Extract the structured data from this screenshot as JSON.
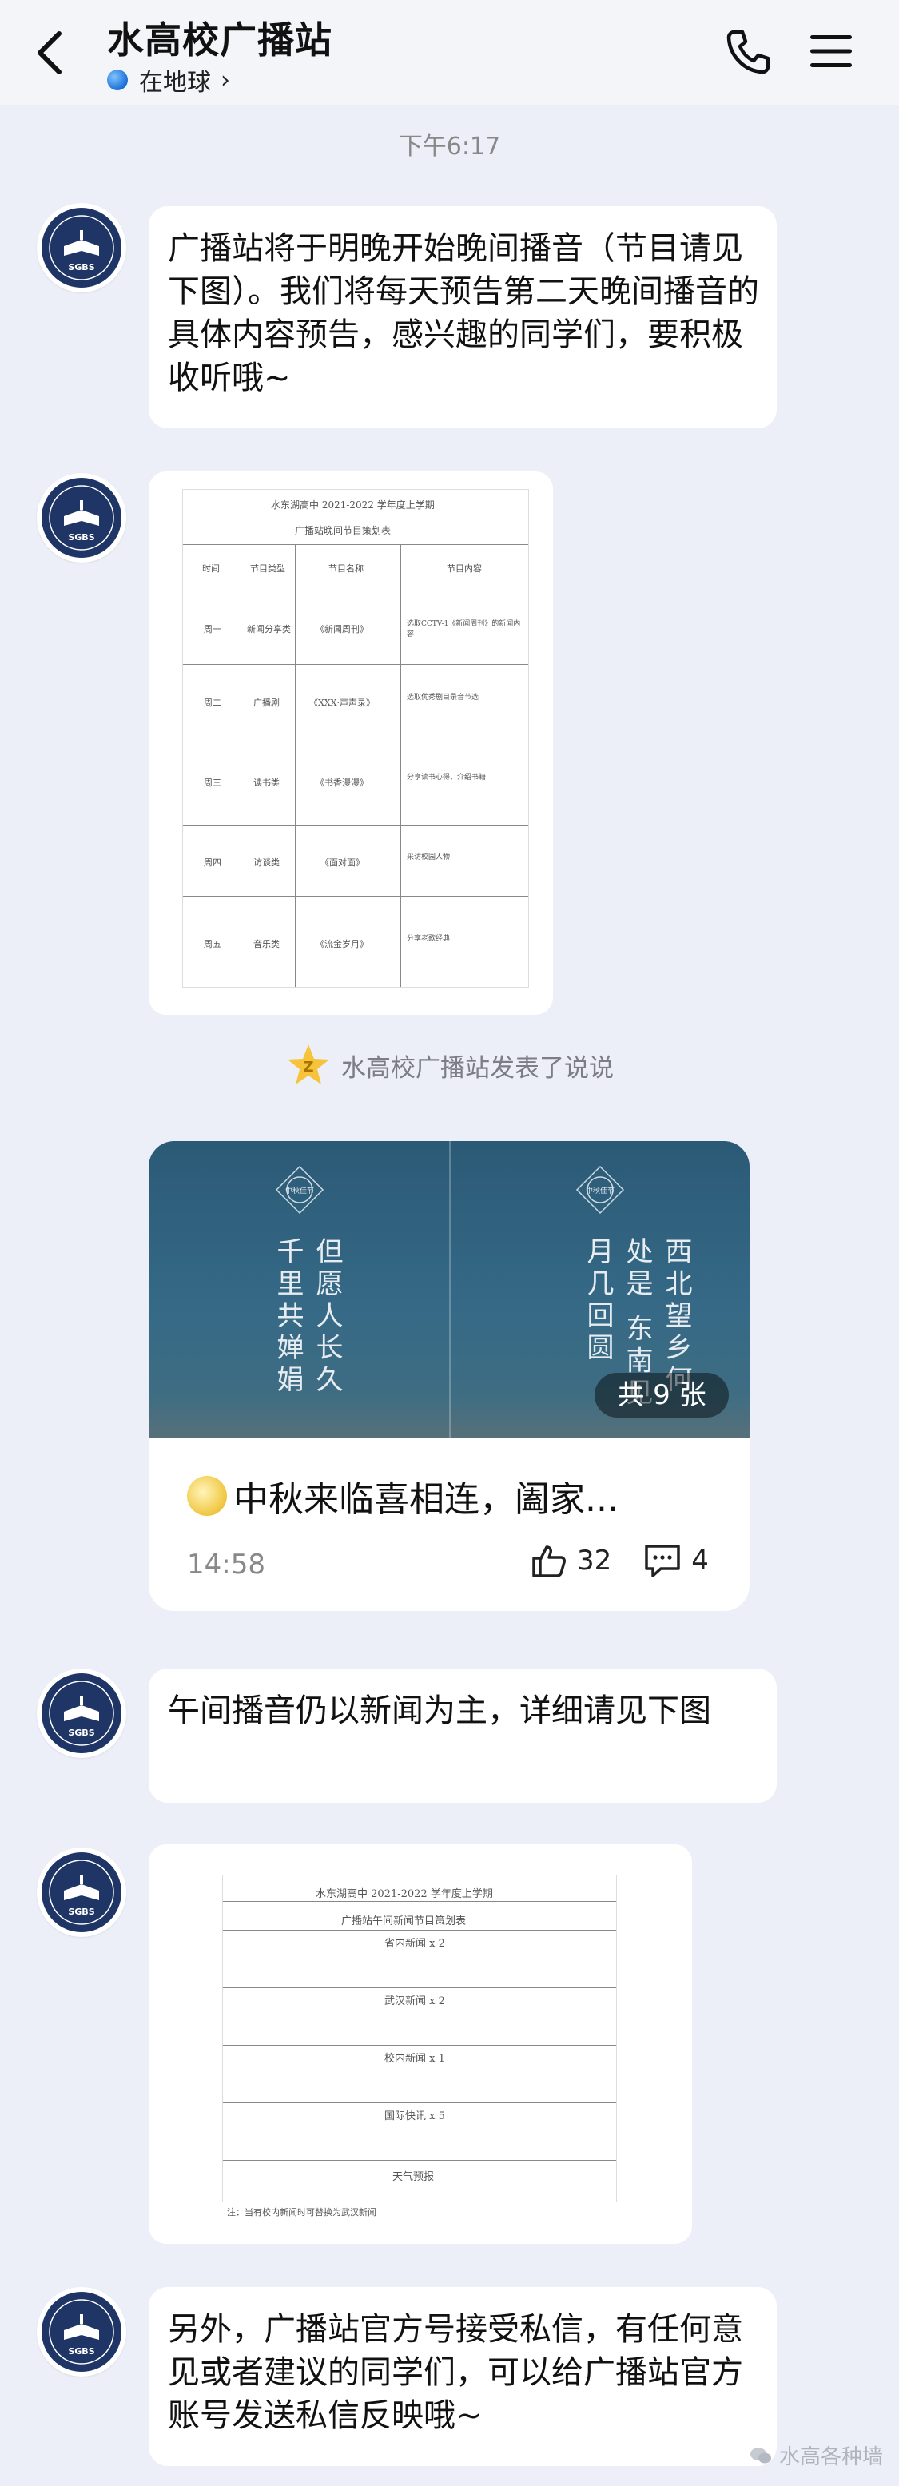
{
  "header": {
    "title": "水高校广播站",
    "location": "在地球",
    "location_chevron": "›"
  },
  "chat": {
    "timestamp": "下午6:17",
    "msg1": "广播站将于明晚开始晚间播音（节目请见下图）。我们将每天预告第二天晚间播音的具体内容预告，感兴趣的同学们，要积极收听哦~",
    "doc1": {
      "title": "水东湖高中 2021-2022 学年度上学期",
      "subtitle": "广播站晚间节目策划表",
      "headers": [
        "时间",
        "节目类型",
        "节目名称",
        "节目内容"
      ],
      "rows": [
        [
          "周一",
          "新闻分享类",
          "《新闻周刊》",
          "选取CCTV-1《新闻周刊》的新闻内容"
        ],
        [
          "周二",
          "广播剧",
          "《XXX·声声录》",
          "选取优秀剧目录音节选"
        ],
        [
          "周三",
          "读书类",
          "《书香漫漫》",
          "分享读书心得，介绍书籍"
        ],
        [
          "周四",
          "访谈类",
          "《面对面》",
          "采访校园人物"
        ],
        [
          "周五",
          "音乐类",
          "《流金岁月》",
          "分享老歌经典"
        ]
      ]
    },
    "notice": "水高校广播站发表了说说",
    "notice_badge": "Z",
    "post": {
      "left_text": "但愿人长久 千里共婵娟",
      "right_text": "西北望乡何处是 东南见月几回圆",
      "badge_label": "中秋佳节",
      "photo_count": "共 9 张",
      "title": "中秋来临喜相连，阖家...",
      "time": "14:58",
      "likes": "32",
      "comments": "4"
    },
    "msg2": "午间播音仍以新闻为主，详细请见下图",
    "doc2": {
      "title": "水东湖高中 2021-2022 学年度上学期",
      "subtitle": "广播站午间新闻节目策划表",
      "rows": [
        "省内新闻 x 2",
        "武汉新闻 x 2",
        "校内新闻 x 1",
        "国际快讯 x 5",
        "天气预报"
      ],
      "note": "注：当有校内新闻时可替换为武汉新闻"
    },
    "msg3": "另外，广播站官方号接受私信，有任何意见或者建议的同学们，可以给广播站官方账号发送私信反映哦~"
  },
  "avatar_text": "SGBS",
  "watermark": "水高各种墙",
  "colors": {
    "background": "#eceff7",
    "bubble": "#ffffff",
    "avatar_navy": "#1f3565"
  }
}
